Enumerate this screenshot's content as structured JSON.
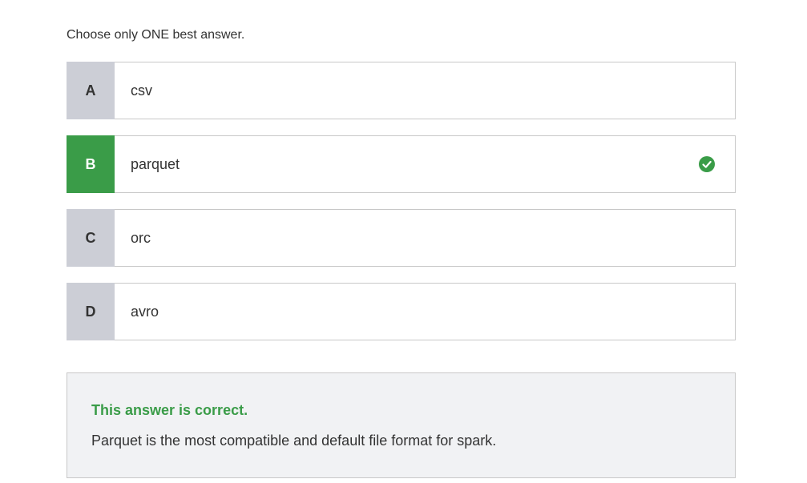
{
  "instruction": "Choose only ONE best answer.",
  "options": [
    {
      "letter": "A",
      "text": "csv",
      "state": "default"
    },
    {
      "letter": "B",
      "text": "parquet",
      "state": "correct",
      "icon": "check-circle-icon"
    },
    {
      "letter": "C",
      "text": "orc",
      "state": "default"
    },
    {
      "letter": "D",
      "text": "avro",
      "state": "default"
    }
  ],
  "feedback": {
    "status": "This answer is correct.",
    "explanation": "Parquet is the most compatible and default file format for spark."
  },
  "colors": {
    "correct": "#3a9c48",
    "letter_bg": "#ccced6",
    "feedback_bg": "#f1f2f4",
    "border": "#c8c8c8"
  }
}
